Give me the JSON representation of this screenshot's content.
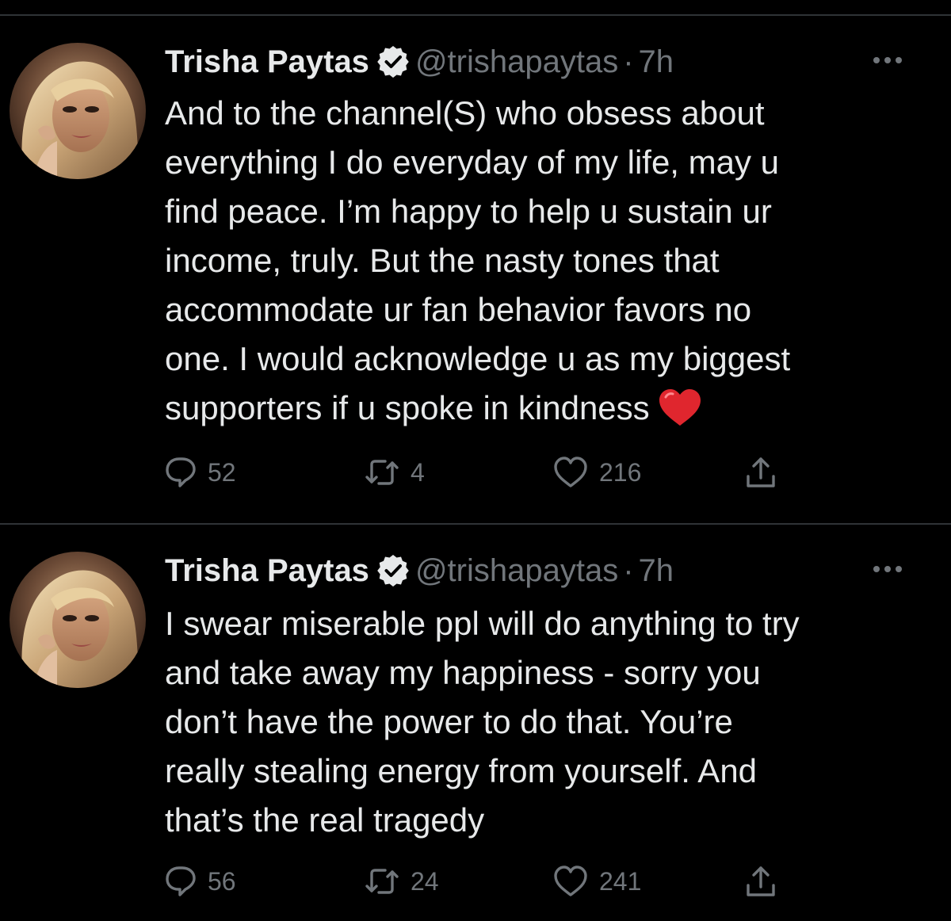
{
  "colors": {
    "background": "#000000",
    "text_primary": "#e7e9ea",
    "text_secondary": "#71767b",
    "divider": "#2f3336",
    "verified_badge": "#e7e9ea",
    "heart_emoji": "#e0262e"
  },
  "tweets": [
    {
      "author": {
        "name": "Trisha Paytas",
        "handle": "@trishapaytas",
        "verified_icon": "verified-badge-icon",
        "avatar": "profile-photo"
      },
      "separator": "·",
      "time": "7h",
      "more_icon": "more-horizontal-icon",
      "text_lines": [
        "And to the channel(S) who obsess about",
        "everything I do everyday of my life, may u",
        "find peace. I’m happy to help u sustain ur",
        "income, truly. But the nasty tones that",
        "accommodate ur fan behavior favors no",
        "one. I would acknowledge u as my biggest",
        "supporters if u spoke in kindness"
      ],
      "trailing_emoji": "red-heart-emoji",
      "stats": {
        "replies": "52",
        "retweets": "4",
        "likes": "216",
        "share_icon": "share-icon"
      }
    },
    {
      "author": {
        "name": "Trisha Paytas",
        "handle": "@trishapaytas",
        "verified_icon": "verified-badge-icon",
        "avatar": "profile-photo"
      },
      "separator": "·",
      "time": "7h",
      "more_icon": "more-horizontal-icon",
      "text_lines": [
        "I swear miserable ppl will do anything to try",
        "and take away my happiness - sorry you",
        "don’t have the power to do that. You’re",
        "really stealing energy from yourself. And",
        "that’s the real tragedy"
      ],
      "stats": {
        "replies": "56",
        "retweets": "24",
        "likes": "241",
        "share_icon": "share-icon"
      }
    }
  ]
}
